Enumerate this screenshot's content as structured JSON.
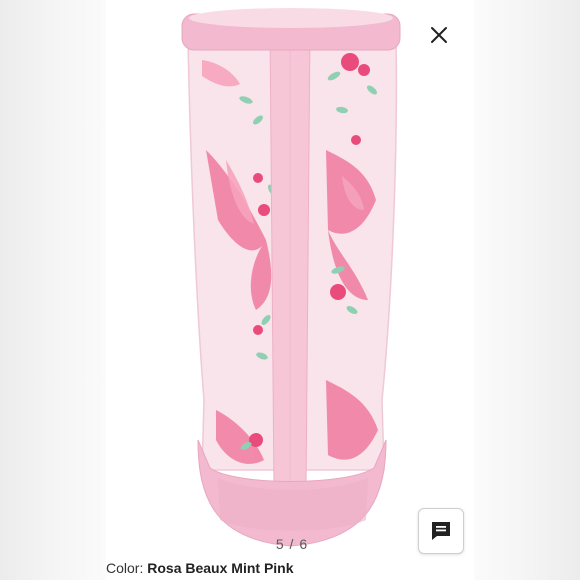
{
  "viewer": {
    "image_alt": "Pink floral rain boot, rear view",
    "counter": "5 / 6",
    "close_icon": "close-icon",
    "chat_icon": "chat-bubble-icon"
  },
  "caption": {
    "label": "Color:",
    "value": "Rosa Beaux Mint Pink"
  },
  "colors": {
    "boot_base": "#f8e4ea",
    "trim_pink": "#f2b9cf",
    "bow_pink": "#f07aa0",
    "rose_pink": "#e94c7c",
    "leaf_mint": "#8fcfb2"
  }
}
